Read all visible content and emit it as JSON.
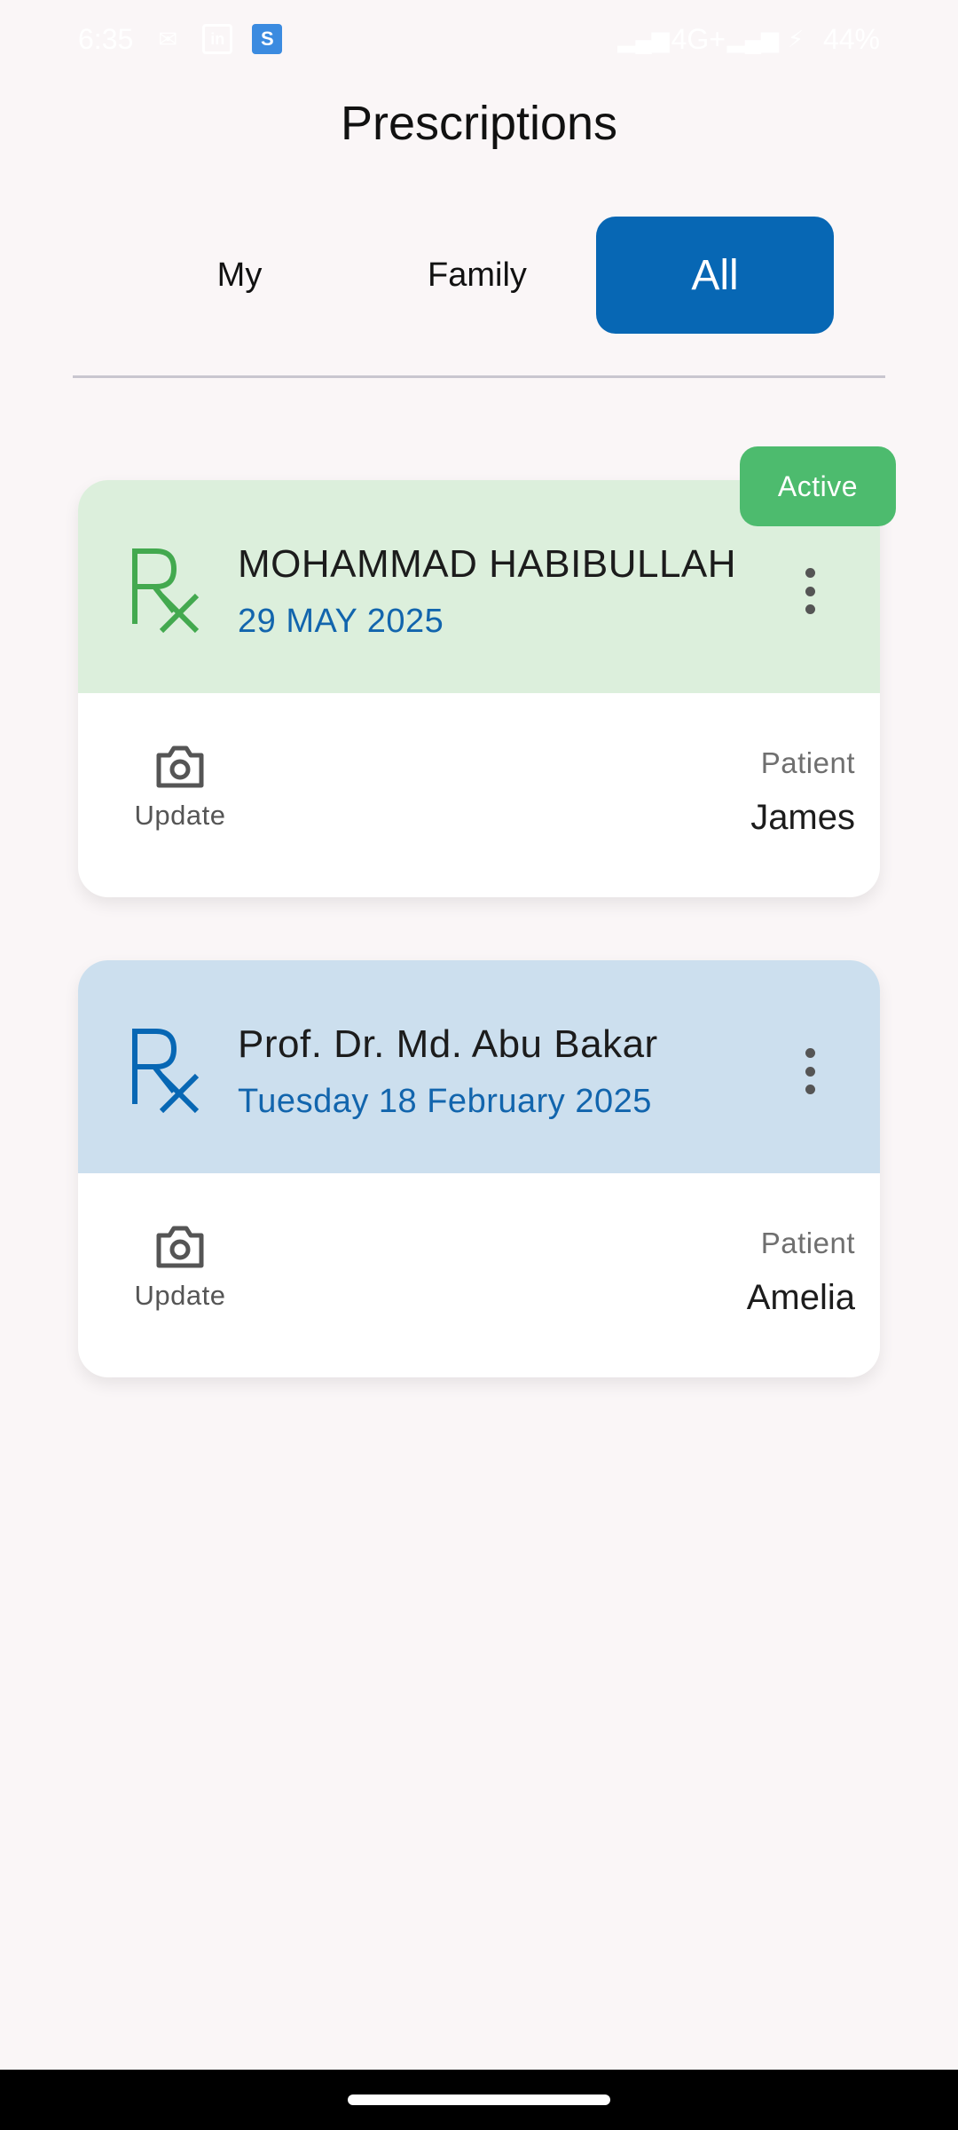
{
  "status_bar": {
    "time": "6:35",
    "network": "4G+",
    "battery": "44%",
    "icons": [
      "mail-icon",
      "linkedin-icon",
      "app-s-icon",
      "signal-icon",
      "charging-icon"
    ]
  },
  "page": {
    "title": "Prescriptions"
  },
  "tabs": [
    {
      "label": "My",
      "active": false
    },
    {
      "label": "Family",
      "active": false
    },
    {
      "label": "All",
      "active": true
    }
  ],
  "prescriptions": [
    {
      "doctor": "MOHAMMAD HABIBULLAH",
      "date": "29 MAY 2025",
      "status": "Active",
      "update_label": "Update",
      "patient_label": "Patient",
      "patient_name": "James",
      "header_color": "#dcefdc",
      "rx_color": "#43a94f"
    },
    {
      "doctor": "Prof. Dr. Md. Abu Bakar",
      "date": "Tuesday 18 February 2025",
      "update_label": "Update",
      "patient_label": "Patient",
      "patient_name": "Amelia",
      "header_color": "#ccdfee",
      "rx_color": "#0767b4"
    }
  ],
  "colors": {
    "accent": "#0767b4",
    "active_badge": "#4dbb6e",
    "date_text": "#1265ad",
    "background": "#faf6f7"
  }
}
